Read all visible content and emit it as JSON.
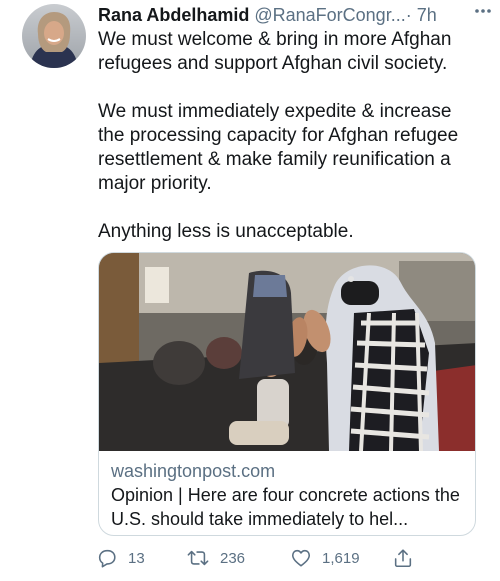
{
  "author": {
    "display_name": "Rana Abdelhamid",
    "handle": "@RanaForCongr...",
    "time": "· 7h"
  },
  "tweet": {
    "paragraphs": [
      "We must welcome & bring in more Afghan refugees and support Afghan civil society.",
      "We must immediately expedite & increase the processing capacity for Afghan refugee resettlement & make family reunification a major priority.",
      "Anything less is unacceptable."
    ]
  },
  "card": {
    "domain": "washingtonpost.com",
    "title": "Opinion | Here are four concrete actions the U.S. should take immediately to hel..."
  },
  "actions": {
    "reply_count": "13",
    "retweet_count": "236",
    "like_count": "1,619"
  },
  "icons": {
    "more": "more-horizontal-icon",
    "reply": "reply-icon",
    "retweet": "retweet-icon",
    "like": "heart-icon",
    "share": "share-icon"
  },
  "colors": {
    "text_primary": "#14171a",
    "text_secondary": "#5b7083",
    "card_border": "#cfd9de",
    "background": "#ffffff"
  }
}
